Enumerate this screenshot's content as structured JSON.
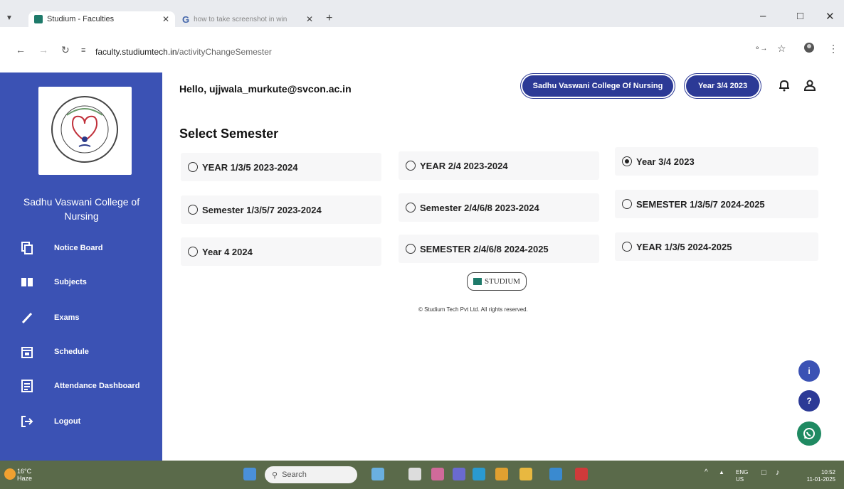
{
  "browser": {
    "tabs": [
      {
        "title": "Studium - Faculties",
        "active": true
      },
      {
        "title": "how to take screenshot in win",
        "active": false
      }
    ],
    "url_host": "faculty.studiumtech.in",
    "url_path": "/activityChangeSemester"
  },
  "sidebar": {
    "college_name": "Sadhu Vaswani College of Nursing",
    "items": [
      {
        "label": "Notice Board",
        "icon": "notice-board-icon"
      },
      {
        "label": "Subjects",
        "icon": "book-icon"
      },
      {
        "label": "Exams",
        "icon": "pencil-icon"
      },
      {
        "label": "Schedule",
        "icon": "calendar-icon"
      },
      {
        "label": "Attendance Dashboard",
        "icon": "clipboard-icon"
      },
      {
        "label": "Logout",
        "icon": "logout-icon"
      }
    ],
    "accent": "#3b52b4"
  },
  "header": {
    "greeting": "Hello, ujjwala_murkute@svcon.ac.in",
    "college_pill": "Sadhu Vaswani College Of Nursing",
    "year_pill": "Year 3/4 2023",
    "pill_color": "#2c3a96"
  },
  "main": {
    "title": "Select Semester",
    "options": [
      {
        "label": "YEAR 1/3/5 2023-2024",
        "selected": false
      },
      {
        "label": "YEAR 2/4 2023-2024",
        "selected": false
      },
      {
        "label": "Year 3/4 2023",
        "selected": true
      },
      {
        "label": "Semester 1/3/5/7 2023-2024",
        "selected": false
      },
      {
        "label": "Semester 2/4/6/8 2023-2024",
        "selected": false
      },
      {
        "label": "SEMESTER 1/3/5/7 2024-2025",
        "selected": false
      },
      {
        "label": "Year 4 2024",
        "selected": false
      },
      {
        "label": "SEMESTER 2/4/6/8 2024-2025",
        "selected": false
      },
      {
        "label": "YEAR 1/3/5 2024-2025",
        "selected": false
      }
    ]
  },
  "footer": {
    "logo_text": "STUDIUM",
    "copyright": "© Studium Tech Pvt Ltd. All rights reserved."
  },
  "fabs": {
    "info": "i",
    "help": "?"
  },
  "taskbar": {
    "temperature": "16°C",
    "weather": "Haze",
    "search_placeholder": "Search",
    "lang": "ENG",
    "region": "US",
    "time": "10:52",
    "date": "11-01-2025"
  }
}
